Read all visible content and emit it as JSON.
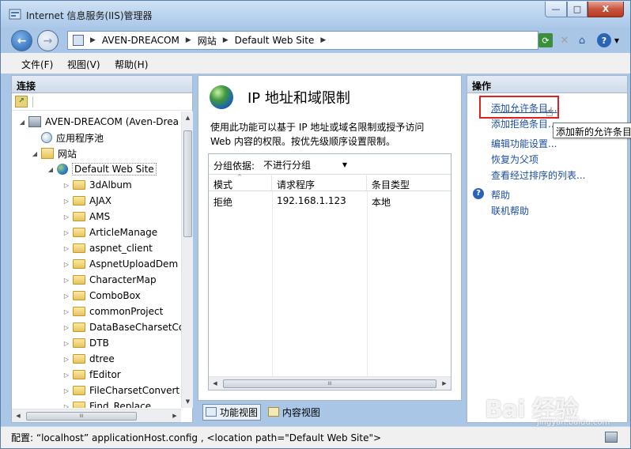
{
  "window": {
    "title": "Internet 信息服务(IIS)管理器",
    "min_glyph": "—",
    "max_glyph": "□",
    "close_glyph": "X"
  },
  "nav": {
    "back_glyph": "←",
    "forward_glyph": "→",
    "address_segments": [
      "AVEN-DREACOM",
      "网站",
      "Default Web Site"
    ],
    "separator": "▶",
    "help_glyph": "?",
    "dropdown_glyph": "▼"
  },
  "menu": [
    "文件(F)",
    "视图(V)",
    "帮助(H)"
  ],
  "left_panel": {
    "header": "连接",
    "tree": [
      {
        "label": "AVEN-DREACOM (Aven-Drea",
        "icon": "server-icon",
        "exp": "◢"
      },
      {
        "label": "应用程序池",
        "icon": "app-pool-icon",
        "exp": ""
      },
      {
        "label": "网站",
        "icon": "sites-folder-icon",
        "exp": "◢"
      },
      {
        "label": "Default Web Site",
        "icon": "globe-icon",
        "exp": "◢"
      },
      {
        "label": "3dAlbum",
        "icon": "folder-icon",
        "exp": "▷"
      },
      {
        "label": "AJAX",
        "icon": "folder-icon",
        "exp": "▷"
      },
      {
        "label": "AMS",
        "icon": "folder-icon",
        "exp": "▷"
      },
      {
        "label": "ArticleManage",
        "icon": "folder-icon",
        "exp": "▷"
      },
      {
        "label": "aspnet_client",
        "icon": "folder-icon",
        "exp": "▷"
      },
      {
        "label": "AspnetUploadDem",
        "icon": "folder-icon",
        "exp": "▷"
      },
      {
        "label": "CharacterMap",
        "icon": "folder-icon",
        "exp": "▷"
      },
      {
        "label": "ComboBox",
        "icon": "folder-icon",
        "exp": "▷"
      },
      {
        "label": "commonProject",
        "icon": "folder-icon",
        "exp": "▷"
      },
      {
        "label": "DataBaseCharsetCo",
        "icon": "folder-icon",
        "exp": "▷"
      },
      {
        "label": "DTB",
        "icon": "folder-icon",
        "exp": "▷"
      },
      {
        "label": "dtree",
        "icon": "folder-icon",
        "exp": "▷"
      },
      {
        "label": "fEditor",
        "icon": "folder-icon",
        "exp": "▷"
      },
      {
        "label": "FileCharsetConvert",
        "icon": "folder-icon",
        "exp": "▷"
      },
      {
        "label": "Find_Replace",
        "icon": "folder-icon",
        "exp": "▷"
      }
    ],
    "scroll_grip": "III"
  },
  "center": {
    "title": "IP 地址和域限制",
    "description": "使用此功能可以基于 IP 地址或域名限制或授予访问 Web 内容的权限。按优先级顺序设置限制。",
    "group_label": "分组依据:",
    "group_value": "不进行分组",
    "columns": [
      "模式",
      "请求程序",
      "条目类型"
    ],
    "rows": [
      {
        "mode": "拒绝",
        "requester": "192.168.1.123",
        "type": "本地"
      }
    ],
    "sort_glyph": "^",
    "scroll_grip": "III",
    "view_tabs": [
      "功能视图",
      "内容视图"
    ]
  },
  "right_panel": {
    "header": "操作",
    "actions": [
      "添加允许条目...",
      "添加拒绝条目...",
      "编辑功能设置...",
      "恢复为父项",
      "查看经过排序的列表..."
    ],
    "help_actions": [
      "帮助",
      "联机帮助"
    ],
    "tooltip": "添加新的允许条目"
  },
  "status": {
    "text": "配置: “localhost” applicationHost.config , <location path=\"Default Web Site\">"
  },
  "watermark": {
    "logo": "Bai 经验",
    "url": "jingyan.baidu.com"
  }
}
